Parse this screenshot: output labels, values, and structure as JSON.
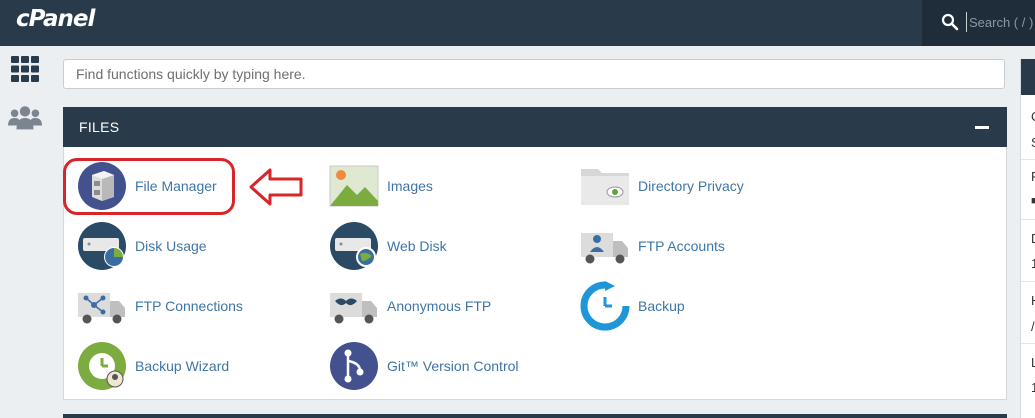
{
  "header": {
    "logo_text": "cPanel",
    "search_placeholder": "Search ( / )"
  },
  "sidebar": {
    "items": [
      {
        "name": "grid-icon"
      },
      {
        "name": "users-icon"
      }
    ]
  },
  "quick_find": {
    "placeholder": "Find functions quickly by typing here."
  },
  "files_section": {
    "title": "FILES",
    "tools": [
      {
        "label": "File Manager",
        "icon": "file-manager-icon"
      },
      {
        "label": "Images",
        "icon": "images-icon"
      },
      {
        "label": "Directory Privacy",
        "icon": "directory-privacy-icon"
      },
      {
        "label": "Disk Usage",
        "icon": "disk-usage-icon"
      },
      {
        "label": "Web Disk",
        "icon": "web-disk-icon"
      },
      {
        "label": "FTP Accounts",
        "icon": "ftp-accounts-icon"
      },
      {
        "label": "FTP Connections",
        "icon": "ftp-connections-icon"
      },
      {
        "label": "Anonymous FTP",
        "icon": "anonymous-ftp-icon"
      },
      {
        "label": "Backup",
        "icon": "backup-icon"
      },
      {
        "label": "Backup Wizard",
        "icon": "backup-wizard-icon"
      },
      {
        "label": "Git™ Version Control",
        "icon": "git-icon"
      }
    ]
  },
  "right_panel": {
    "letters": [
      "C",
      "S",
      "P",
      "",
      "D",
      "1",
      "H",
      "/",
      "L",
      "1"
    ]
  },
  "annotation": {
    "highlight_color": "#d7262a"
  },
  "colors": {
    "header_bg": "#293a4a",
    "link": "#3f75a6",
    "background": "#eceff1"
  }
}
